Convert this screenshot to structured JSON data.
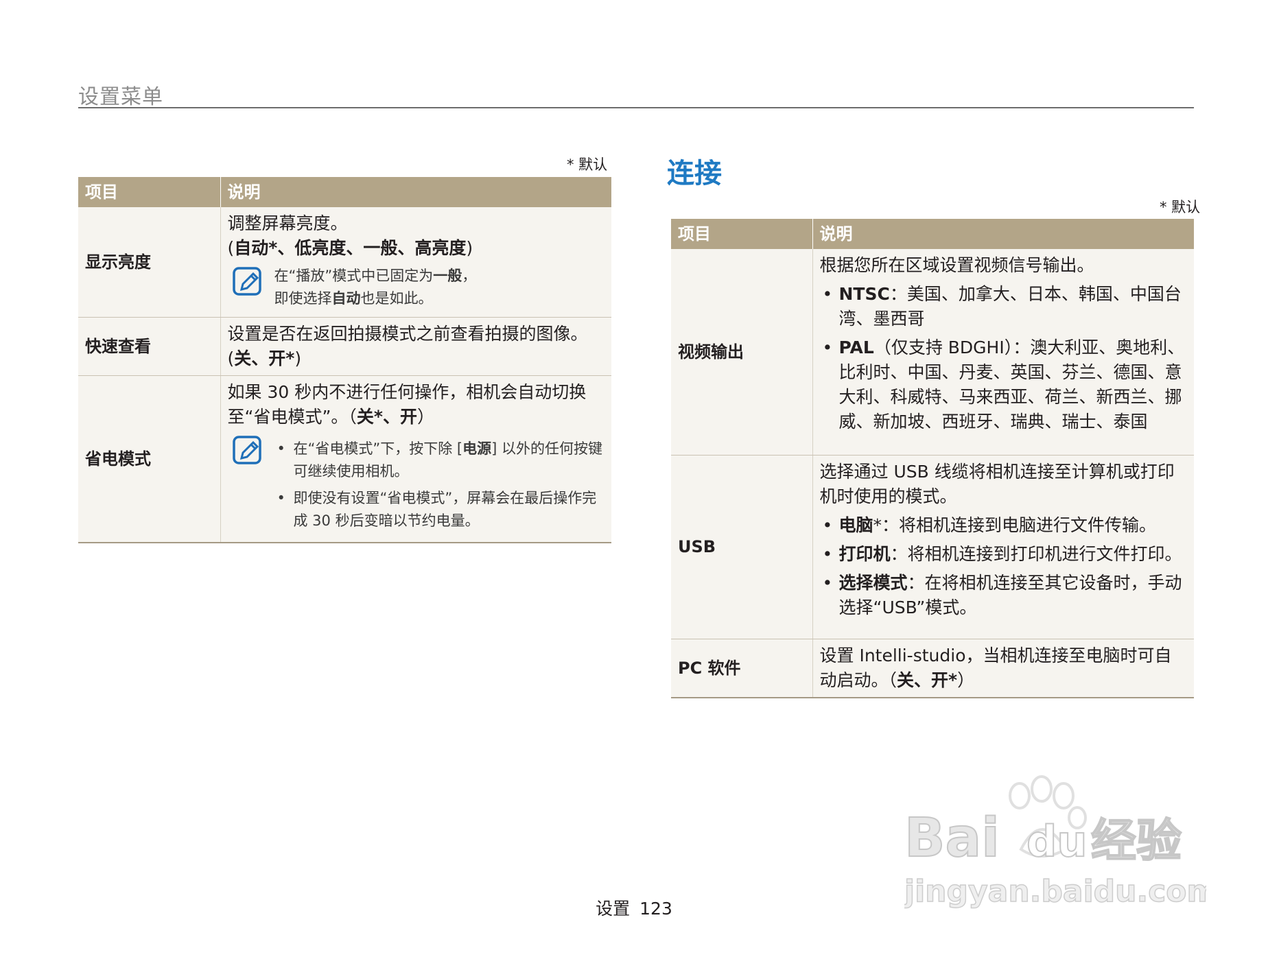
{
  "header": {
    "section_title": "设置菜单"
  },
  "left_table": {
    "default_note": "* 默认",
    "col_item": "项目",
    "col_desc": "说明",
    "rows": [
      {
        "item": "显示亮度",
        "line1": "调整屏幕亮度。",
        "line2_open": "(",
        "line2_bold": "自动*、低亮度、一般、高亮度",
        "line2_close": ")",
        "note_p1": "在“播放”模式中已固定为",
        "note_p1_bold": "一般",
        "note_p1_end": "，",
        "note_p2_start": "即使选择",
        "note_p2_bold": "自动",
        "note_p2_end": "也是如此。"
      },
      {
        "item": "快速查看",
        "text": "设置是否在返回拍摄模式之前查看拍摄的图像。(",
        "bold": "关、开*",
        "close": ")"
      },
      {
        "item": "省电模式",
        "text": "如果 30 秒内不进行任何操作，相机会自动切换至“省电模式”。（",
        "bold": "关*、开",
        "close": "）",
        "note1_start": "在“省电模式”下，按下除 [",
        "note1_bold": "电源",
        "note1_end": "] 以外的任何按键可继续使用相机。",
        "note2": "即使没有设置“省电模式”，屏幕会在最后操作完成 30 秒后变暗以节约电量。"
      }
    ]
  },
  "right_section": {
    "title": "连接",
    "default_note": "* 默认",
    "col_item": "项目",
    "col_desc": "说明",
    "rows": [
      {
        "item": "视频输出",
        "text": "根据您所在区域设置视频信号输出。",
        "b1_bold": "NTSC",
        "b1_text": "：美国、加拿大、日本、韩国、中国台湾、墨西哥",
        "b2_bold": "PAL",
        "b2_text": "（仅支持 BDGHI）：澳大利亚、奥地利、比利时、中国、丹麦、英国、芬兰、德国、意大利、科威特、马来西亚、荷兰、新西兰、挪威、新加坡、西班牙、瑞典、瑞士、泰国"
      },
      {
        "item": "USB",
        "text": "选择通过 USB 线缆将相机连接至计算机或打印机时使用的模式。",
        "b1_bold": "电脑",
        "b1_text": "*：将相机连接到电脑进行文件传输。",
        "b2_bold": "打印机",
        "b2_text": "：将相机连接到打印机进行文件打印。",
        "b3_bold": "选择模式",
        "b3_text": "：在将相机连接至其它设备时，手动选择“USB”模式。"
      },
      {
        "item": "PC 软件",
        "text": "设置 Intelli-studio，当相机连接至电脑时可自动启动。（",
        "bold": "关、开*",
        "close": "）"
      }
    ]
  },
  "footer": {
    "label": "设置",
    "page": "123"
  },
  "watermark": {
    "brand": "Bai",
    "brand2": "du",
    "cn": "经验",
    "url": "jingyan.baidu.com"
  },
  "colors": {
    "header_bg": "#b3a588",
    "accent": "#1f7ac3",
    "cell_bg": "#f6f4ef",
    "note_icon": "#1f6fb8"
  }
}
